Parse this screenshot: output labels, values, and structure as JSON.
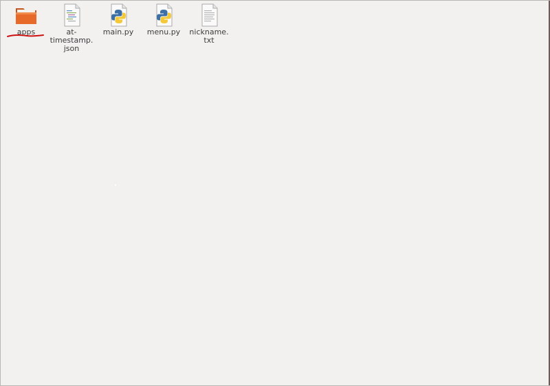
{
  "desktop": {
    "files": [
      {
        "name": "apps",
        "type": "folder",
        "icon": "folder-icon",
        "color": "#e86a2a"
      },
      {
        "name": "at-\ntimestamp.\njson",
        "type": "text",
        "icon": "json-file-icon"
      },
      {
        "name": "main.py",
        "type": "python",
        "icon": "python-file-icon"
      },
      {
        "name": "menu.py",
        "type": "python",
        "icon": "python-file-icon"
      },
      {
        "name": "nickname.\ntxt",
        "type": "text",
        "icon": "text-file-icon"
      }
    ],
    "annotation_color": "#cc1111"
  }
}
